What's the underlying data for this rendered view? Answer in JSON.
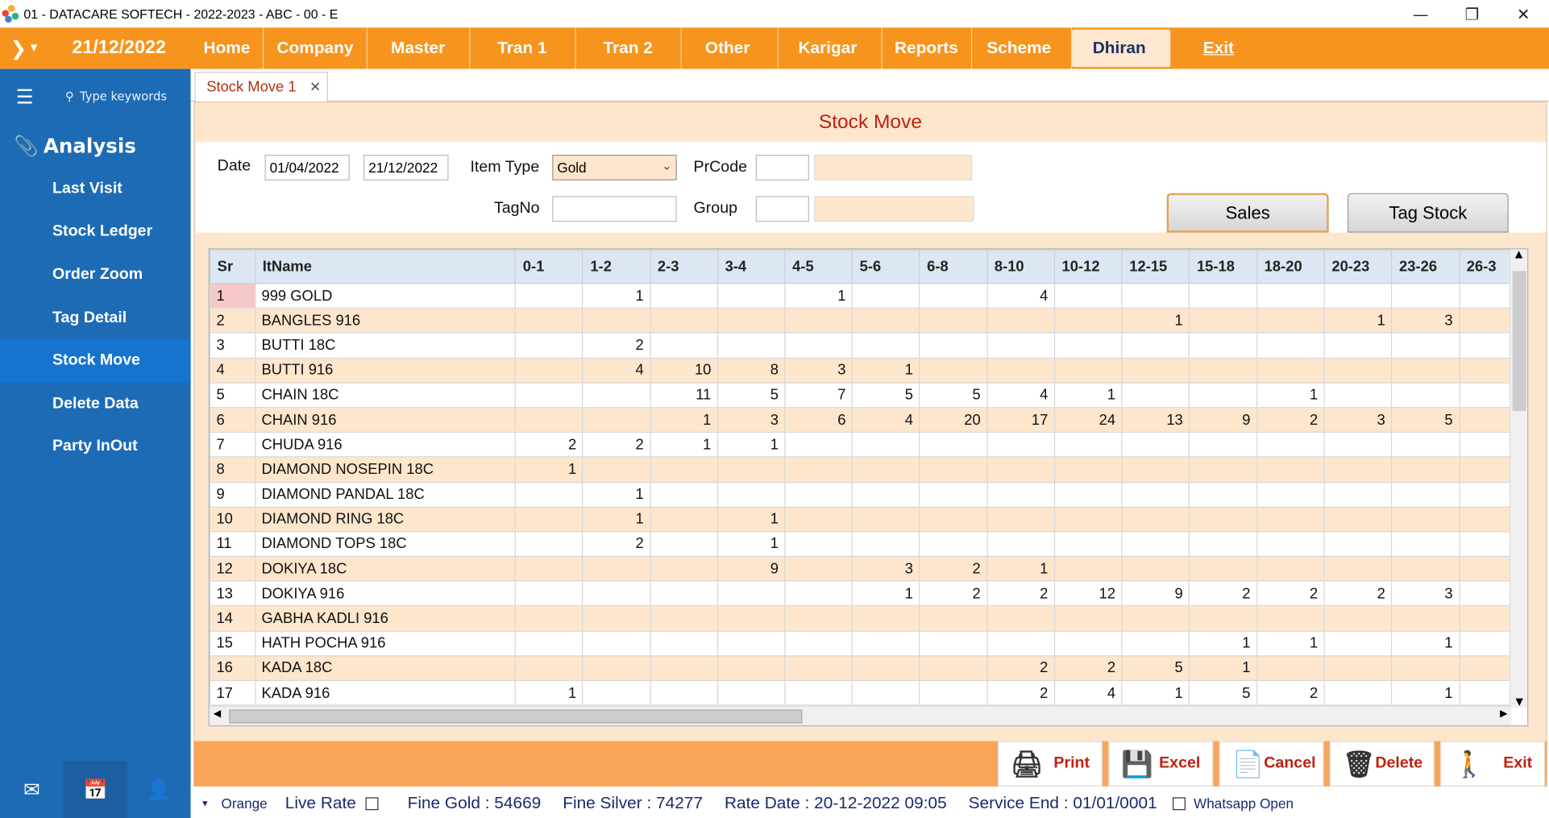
{
  "window": {
    "title": "01 - DATACARE SOFTECH - 2022-2023 - ABC - 00 - E",
    "controls": [
      "minimize",
      "restore",
      "close"
    ]
  },
  "menubar": {
    "date": "21/12/2022",
    "items": [
      "Home",
      "Company",
      "Master",
      "Tran 1",
      "Tran 2",
      "Other",
      "Karigar",
      "Reports",
      "Scheme",
      "Dhiran",
      "Exit"
    ],
    "active": "Dhiran"
  },
  "sidebar": {
    "search_placeholder": "Type keywords",
    "section": "Analysis",
    "items": [
      "Last Visit",
      "Stock Ledger",
      "Order Zoom",
      "Tag Detail",
      "Stock Move",
      "Delete Data",
      "Party InOut"
    ],
    "active": "Stock Move"
  },
  "tab": {
    "label": "Stock Move 1",
    "close": "✕"
  },
  "form": {
    "heading": "Stock Move",
    "date_label": "Date",
    "date_from": "01/04/2022",
    "date_to": "21/12/2022",
    "item_type_label": "Item Type",
    "item_type": "Gold",
    "prcode_label": "PrCode",
    "tagno_label": "TagNo",
    "group_label": "Group",
    "sales_button": "Sales",
    "tagstock_button": "Tag Stock"
  },
  "grid": {
    "columns": [
      "Sr",
      "ItName",
      "0-1",
      "1-2",
      "2-3",
      "3-4",
      "4-5",
      "5-6",
      "6-8",
      "8-10",
      "10-12",
      "12-15",
      "15-18",
      "18-20",
      "20-23",
      "23-26",
      "26-3"
    ],
    "rows": [
      [
        "1",
        "999 GOLD",
        "",
        "1",
        "",
        "",
        "1",
        "",
        "",
        "4",
        "",
        "",
        "",
        "",
        "",
        "",
        ""
      ],
      [
        "2",
        "BANGLES 916",
        "",
        "",
        "",
        "",
        "",
        "",
        "",
        "",
        "",
        "1",
        "",
        "",
        "1",
        "3",
        ""
      ],
      [
        "3",
        "BUTTI 18C",
        "",
        "2",
        "",
        "",
        "",
        "",
        "",
        "",
        "",
        "",
        "",
        "",
        "",
        "",
        ""
      ],
      [
        "4",
        "BUTTI 916",
        "",
        "4",
        "10",
        "8",
        "3",
        "1",
        "",
        "",
        "",
        "",
        "",
        "",
        "",
        "",
        ""
      ],
      [
        "5",
        "CHAIN 18C",
        "",
        "",
        "11",
        "5",
        "7",
        "5",
        "5",
        "4",
        "1",
        "",
        "",
        "1",
        "",
        "",
        ""
      ],
      [
        "6",
        "CHAIN 916",
        "",
        "",
        "1",
        "3",
        "6",
        "4",
        "20",
        "17",
        "24",
        "13",
        "9",
        "2",
        "3",
        "5",
        ""
      ],
      [
        "7",
        "CHUDA 916",
        "2",
        "2",
        "1",
        "1",
        "",
        "",
        "",
        "",
        "",
        "",
        "",
        "",
        "",
        "",
        ""
      ],
      [
        "8",
        "DIAMOND NOSEPIN 18C",
        "1",
        "",
        "",
        "",
        "",
        "",
        "",
        "",
        "",
        "",
        "",
        "",
        "",
        "",
        ""
      ],
      [
        "9",
        "DIAMOND PANDAL  18C",
        "",
        "1",
        "",
        "",
        "",
        "",
        "",
        "",
        "",
        "",
        "",
        "",
        "",
        "",
        ""
      ],
      [
        "10",
        "DIAMOND RING  18C",
        "",
        "1",
        "",
        "1",
        "",
        "",
        "",
        "",
        "",
        "",
        "",
        "",
        "",
        "",
        ""
      ],
      [
        "11",
        "DIAMOND TOPS  18C",
        "",
        "2",
        "",
        "1",
        "",
        "",
        "",
        "",
        "",
        "",
        "",
        "",
        "",
        "",
        ""
      ],
      [
        "12",
        "DOKIYA 18C",
        "",
        "",
        "",
        "9",
        "",
        "3",
        "2",
        "1",
        "",
        "",
        "",
        "",
        "",
        "",
        ""
      ],
      [
        "13",
        "DOKIYA 916",
        "",
        "",
        "",
        "",
        "",
        "1",
        "2",
        "2",
        "12",
        "9",
        "2",
        "2",
        "2",
        "3",
        ""
      ],
      [
        "14",
        "GABHA KADLI 916",
        "",
        "",
        "",
        "",
        "",
        "",
        "",
        "",
        "",
        "",
        "",
        "",
        "",
        "",
        ""
      ],
      [
        "15",
        "HATH POCHA 916",
        "",
        "",
        "",
        "",
        "",
        "",
        "",
        "",
        "",
        "",
        "1",
        "1",
        "",
        "1",
        ""
      ],
      [
        "16",
        "KADA 18C",
        "",
        "",
        "",
        "",
        "",
        "",
        "",
        "2",
        "2",
        "5",
        "1",
        "",
        "",
        "",
        ""
      ],
      [
        "17",
        "KADA 916",
        "1",
        "",
        "",
        "",
        "",
        "",
        "",
        "2",
        "4",
        "1",
        "5",
        "2",
        "",
        "1",
        ""
      ]
    ]
  },
  "actions": [
    "Print",
    "Excel",
    "Cancel",
    "Delete",
    "Exit"
  ],
  "status": {
    "theme": "Orange",
    "live_rate": "Live Rate",
    "fine_gold": "Fine Gold : 54669",
    "fine_silver": "Fine Silver : 74277",
    "rate_date": "Rate Date : 20-12-2022 09:05",
    "service_end": "Service End :  01/01/0001",
    "whatsapp": "Whatsapp Open"
  },
  "colors": {
    "menubar": "#f7941d",
    "sidebar": "#1d6bb5",
    "row_alt": "#fde6cc",
    "heading": "#c02010"
  }
}
